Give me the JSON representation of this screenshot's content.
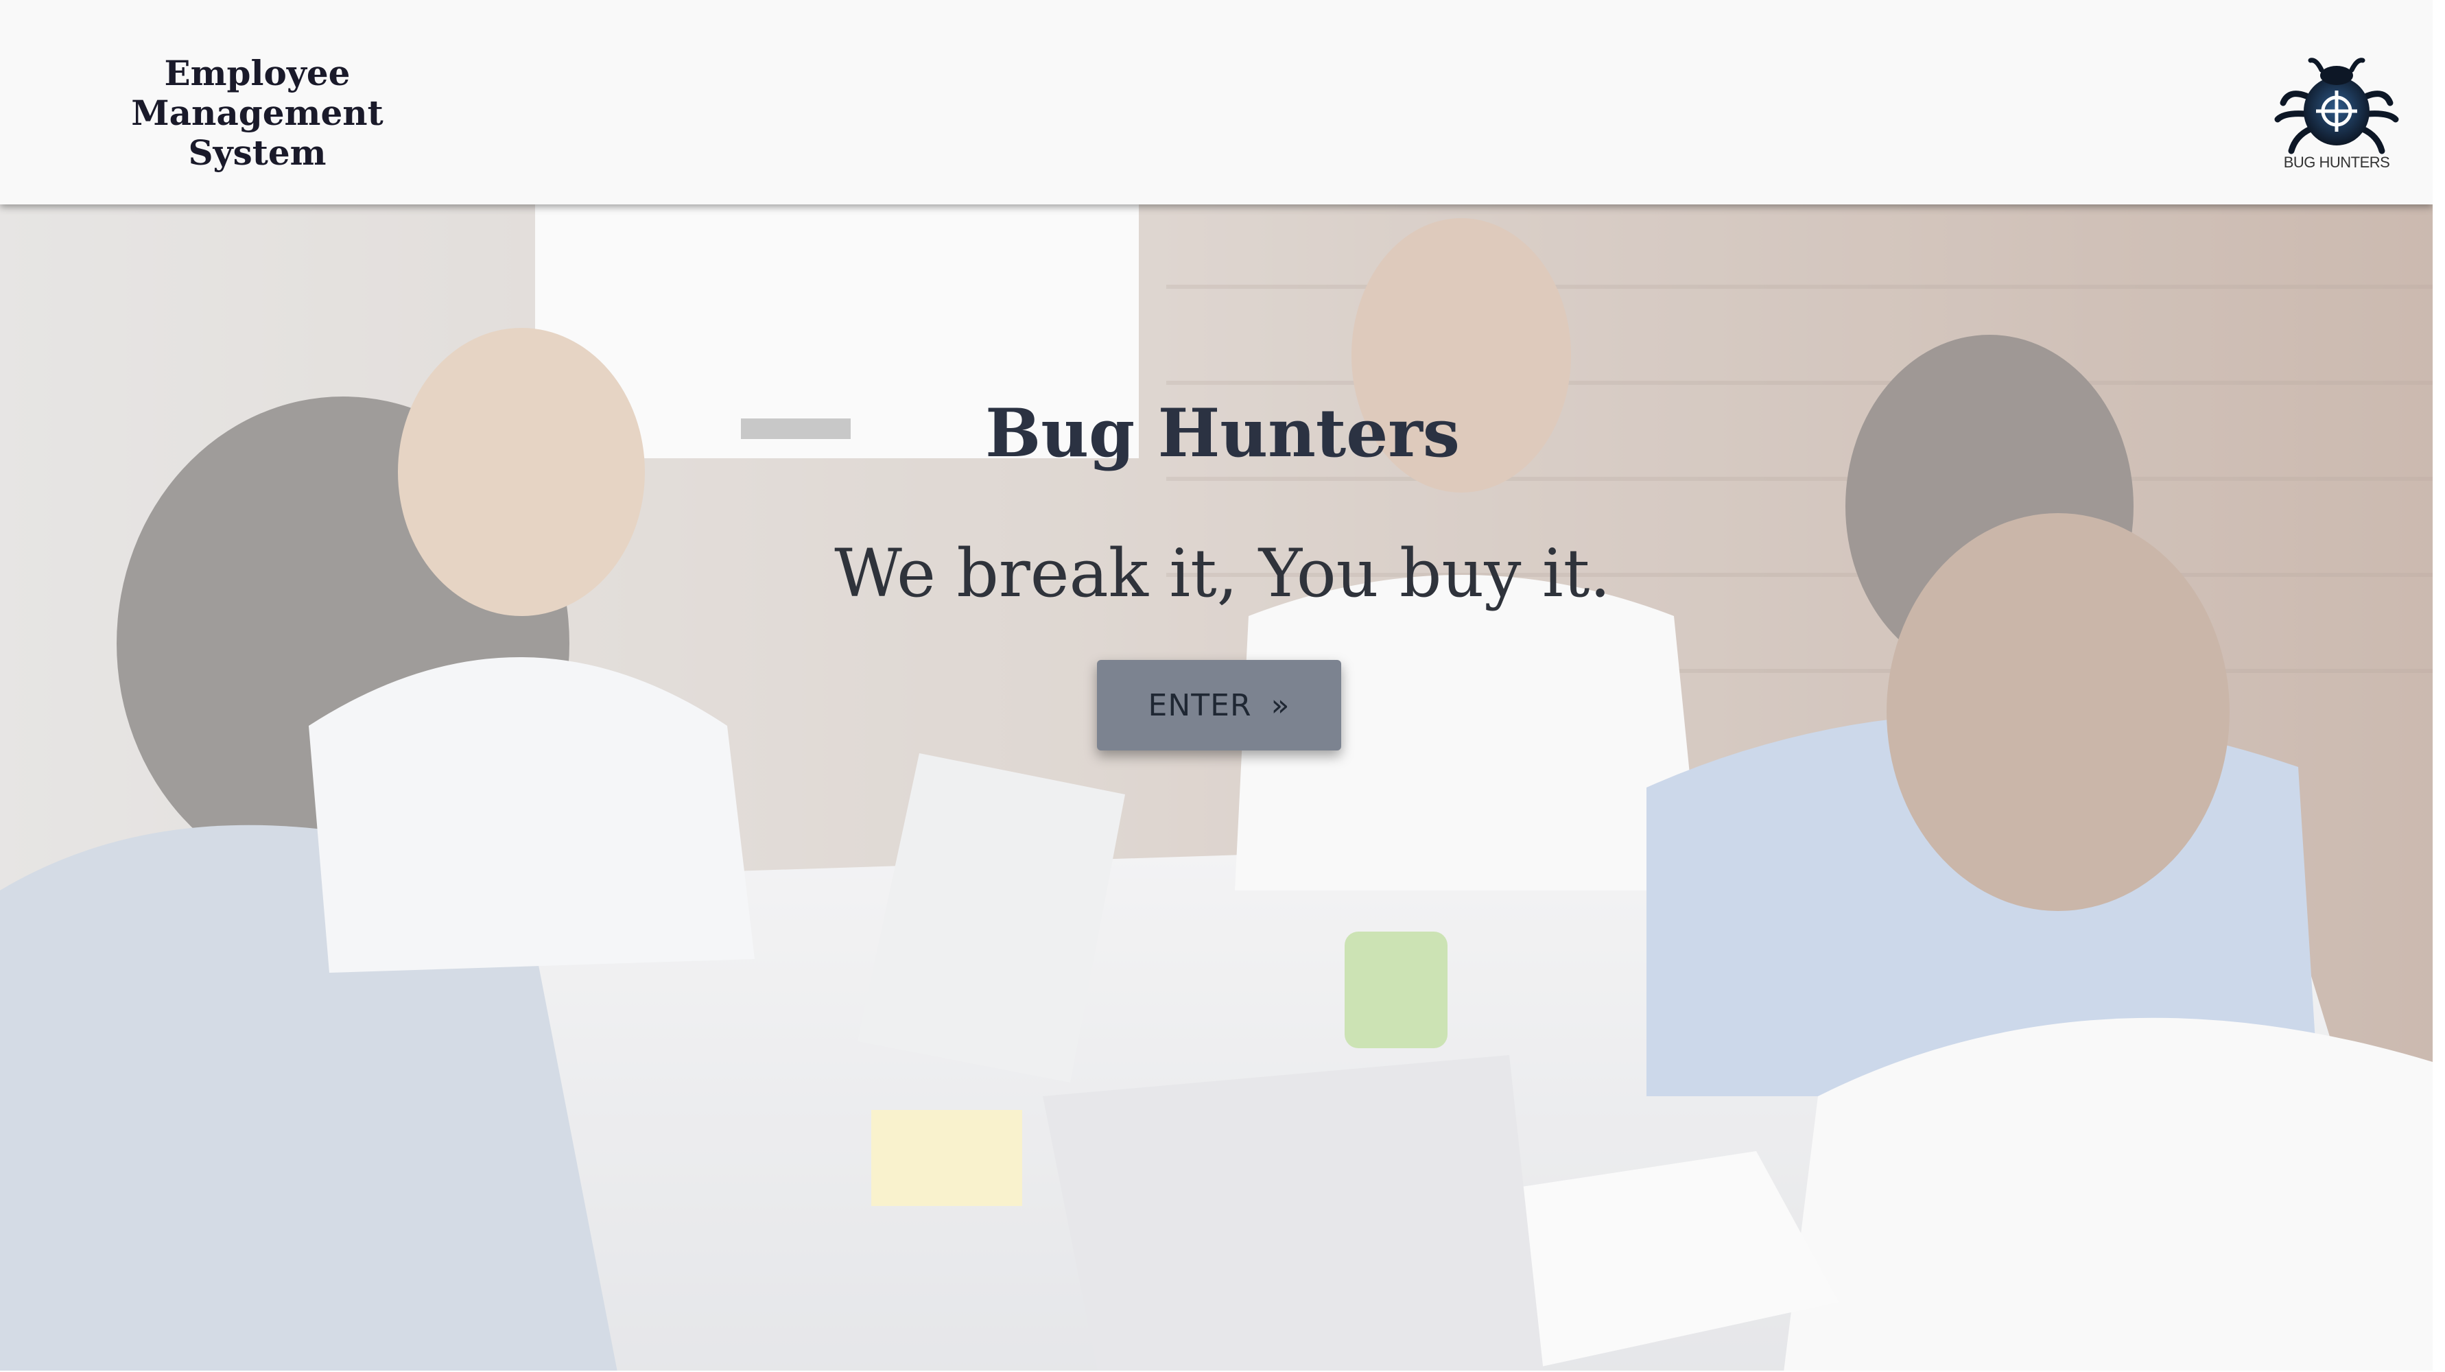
{
  "header": {
    "brand_lines": [
      "Employee",
      "Management",
      "System"
    ],
    "logo": {
      "icon": "bug-crosshair-icon",
      "text": "BUG HUNTERS"
    }
  },
  "hero": {
    "title": "Bug Hunters",
    "tagline": "We break it, You buy it.",
    "enter_button": {
      "label": "ENTER",
      "icon": "double-chevron-right-icon",
      "glyph": "»"
    },
    "background_image": "team-meeting-photo"
  },
  "colors": {
    "header_bg": "#f9f9f9",
    "title": "#2b3242",
    "button_bg": "#7c8390",
    "button_text": "#1f2733"
  }
}
